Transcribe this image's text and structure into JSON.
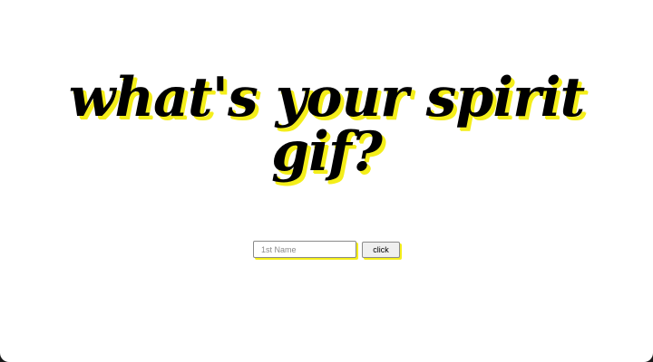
{
  "headline": {
    "line1": "what's your spirit",
    "line2": "gif?"
  },
  "form": {
    "name_input": {
      "placeholder": "1st Name",
      "value": ""
    },
    "submit_label": "click"
  },
  "colors": {
    "background": "#ffffff",
    "text": "#000000",
    "accent_shadow": "#f4ee1a"
  }
}
